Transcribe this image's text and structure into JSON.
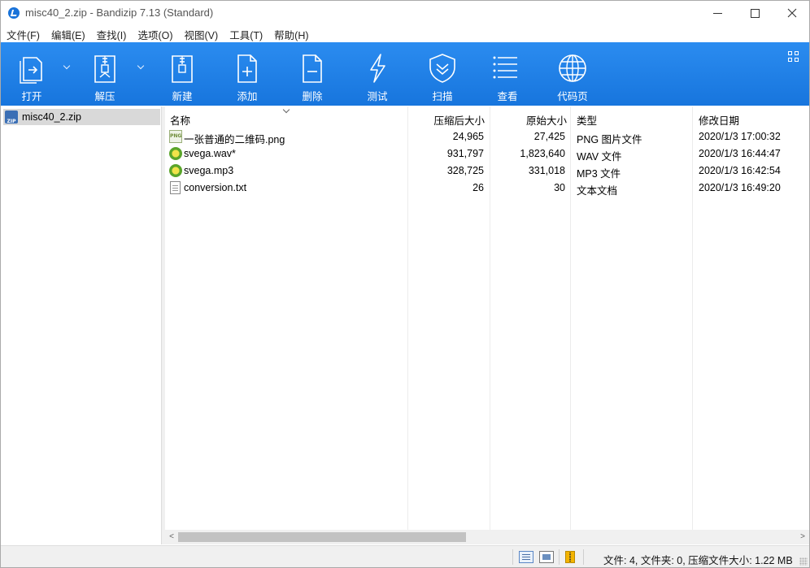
{
  "title": "misc40_2.zip - Bandizip 7.13 (Standard)",
  "window_controls": {
    "minimize": "minimize-icon",
    "maximize": "maximize-icon",
    "close": "×"
  },
  "menu": [
    "文件(F)",
    "编辑(E)",
    "查找(I)",
    "选项(O)",
    "视图(V)",
    "工具(T)",
    "帮助(H)"
  ],
  "toolbar": {
    "open": "打开",
    "extract": "解压",
    "new": "新建",
    "add": "添加",
    "delete": "删除",
    "test": "测试",
    "scan": "扫描",
    "view": "查看",
    "codepage": "代码页"
  },
  "colors": {
    "toolbar_blue": "#1f80e8",
    "selection_gray": "#d9d9d9"
  },
  "tree": {
    "items": [
      {
        "label": "misc40_2.zip",
        "icon": "zip-archive-icon",
        "selected": true
      }
    ]
  },
  "list": {
    "columns": [
      "名称",
      "压缩后大小",
      "原始大小",
      "类型",
      "修改日期"
    ],
    "sort_column": "名称",
    "rows": [
      {
        "name": "一张普通的二维码.png",
        "icon": "png-file-icon",
        "packed": "24,965",
        "size": "27,425",
        "type": "PNG 图片文件",
        "modified": "2020/1/3 17:00:32"
      },
      {
        "name": "svega.wav*",
        "icon": "audio-file-icon",
        "packed": "931,797",
        "size": "1,823,640",
        "type": "WAV 文件",
        "modified": "2020/1/3 16:44:47"
      },
      {
        "name": "svega.mp3",
        "icon": "audio-file-icon",
        "packed": "328,725",
        "size": "331,018",
        "type": "MP3 文件",
        "modified": "2020/1/3 16:42:54"
      },
      {
        "name": "conversion.txt",
        "icon": "text-file-icon",
        "packed": "26",
        "size": "30",
        "type": "文本文档",
        "modified": "2020/1/3 16:49:20"
      }
    ]
  },
  "scrollbar": {
    "left_arrow": "<",
    "right_arrow": ">"
  },
  "status": {
    "text": "文件: 4, 文件夹: 0, 压缩文件大小: 1.22 MB"
  }
}
